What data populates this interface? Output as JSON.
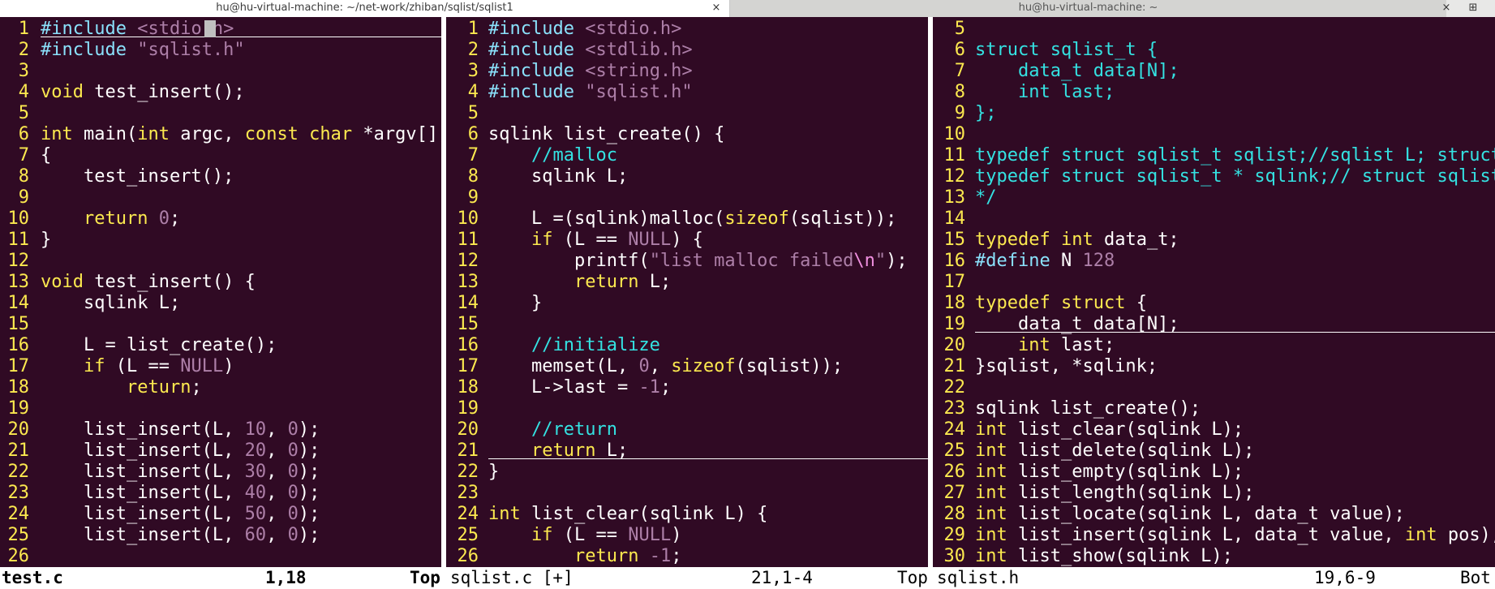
{
  "tabs": [
    {
      "title": "hu@hu-virtual-machine: ~/net-work/zhiban/sqlist/sqlist1",
      "close": "×",
      "active": true
    },
    {
      "title": "hu@hu-virtual-machine: ~",
      "close": "×",
      "active": false
    }
  ],
  "new_tab_icon": "⊞",
  "overflow_label": "Bot",
  "colors": {
    "background": "#300a24",
    "line_number": "#fce94f",
    "keyword": "#fce94f",
    "preprocessor": "#8ae1fb",
    "string": "#ad7fa8",
    "comment": "#34e2e2"
  },
  "panes": [
    {
      "id": "left",
      "lines": [
        {
          "n": "1",
          "tokens": [
            [
              "pp",
              "#include "
            ],
            [
              "str",
              "<stdio.h>"
            ]
          ]
        },
        {
          "n": "2",
          "tokens": [
            [
              "pp",
              "#include "
            ],
            [
              "str",
              "\"sqlist.h\""
            ]
          ]
        },
        {
          "n": "3",
          "tokens": []
        },
        {
          "n": "4",
          "tokens": [
            [
              "kw",
              "void"
            ],
            [
              "plain",
              " test_insert();"
            ]
          ]
        },
        {
          "n": "5",
          "tokens": []
        },
        {
          "n": "6",
          "tokens": [
            [
              "kw",
              "int"
            ],
            [
              "plain",
              " main("
            ],
            [
              "kw",
              "int"
            ],
            [
              "plain",
              " argc, "
            ],
            [
              "kw",
              "const char"
            ],
            [
              "plain",
              " *argv[])"
            ]
          ]
        },
        {
          "n": "7",
          "tokens": [
            [
              "plain",
              "{"
            ]
          ]
        },
        {
          "n": "8",
          "tokens": [
            [
              "plain",
              "    test_insert();"
            ]
          ]
        },
        {
          "n": "9",
          "tokens": []
        },
        {
          "n": "10",
          "tokens": [
            [
              "plain",
              "    "
            ],
            [
              "kw",
              "return"
            ],
            [
              "plain",
              " "
            ],
            [
              "num",
              "0"
            ],
            [
              "plain",
              ";"
            ]
          ]
        },
        {
          "n": "11",
          "tokens": [
            [
              "plain",
              "}"
            ]
          ]
        },
        {
          "n": "12",
          "tokens": []
        },
        {
          "n": "13",
          "tokens": [
            [
              "kw",
              "void"
            ],
            [
              "plain",
              " test_insert() {"
            ]
          ]
        },
        {
          "n": "14",
          "tokens": [
            [
              "plain",
              "    sqlink L;"
            ]
          ]
        },
        {
          "n": "15",
          "tokens": []
        },
        {
          "n": "16",
          "tokens": [
            [
              "plain",
              "    L = list_create();"
            ]
          ]
        },
        {
          "n": "17",
          "tokens": [
            [
              "plain",
              "    "
            ],
            [
              "kw",
              "if"
            ],
            [
              "plain",
              " (L == "
            ],
            [
              "num",
              "NULL"
            ],
            [
              "plain",
              ")"
            ]
          ]
        },
        {
          "n": "18",
          "tokens": [
            [
              "plain",
              "        "
            ],
            [
              "kw",
              "return"
            ],
            [
              "plain",
              ";"
            ]
          ]
        },
        {
          "n": "19",
          "tokens": []
        },
        {
          "n": "20",
          "tokens": [
            [
              "plain",
              "    list_insert(L, "
            ],
            [
              "num",
              "10"
            ],
            [
              "plain",
              ", "
            ],
            [
              "num",
              "0"
            ],
            [
              "plain",
              ");"
            ]
          ]
        },
        {
          "n": "21",
          "tokens": [
            [
              "plain",
              "    list_insert(L, "
            ],
            [
              "num",
              "20"
            ],
            [
              "plain",
              ", "
            ],
            [
              "num",
              "0"
            ],
            [
              "plain",
              ");"
            ]
          ]
        },
        {
          "n": "22",
          "tokens": [
            [
              "plain",
              "    list_insert(L, "
            ],
            [
              "num",
              "30"
            ],
            [
              "plain",
              ", "
            ],
            [
              "num",
              "0"
            ],
            [
              "plain",
              ");"
            ]
          ]
        },
        {
          "n": "23",
          "tokens": [
            [
              "plain",
              "    list_insert(L, "
            ],
            [
              "num",
              "40"
            ],
            [
              "plain",
              ", "
            ],
            [
              "num",
              "0"
            ],
            [
              "plain",
              ");"
            ]
          ]
        },
        {
          "n": "24",
          "tokens": [
            [
              "plain",
              "    list_insert(L, "
            ],
            [
              "num",
              "50"
            ],
            [
              "plain",
              ", "
            ],
            [
              "num",
              "0"
            ],
            [
              "plain",
              ");"
            ]
          ]
        },
        {
          "n": "25",
          "tokens": [
            [
              "plain",
              "    list_insert(L, "
            ],
            [
              "num",
              "60"
            ],
            [
              "plain",
              ", "
            ],
            [
              "num",
              "0"
            ],
            [
              "plain",
              ");"
            ]
          ]
        },
        {
          "n": "26",
          "tokens": []
        }
      ]
    },
    {
      "id": "middle",
      "lines": [
        {
          "n": "1",
          "tokens": [
            [
              "pp",
              "#include "
            ],
            [
              "str",
              "<stdio.h>"
            ]
          ]
        },
        {
          "n": "2",
          "tokens": [
            [
              "pp",
              "#include "
            ],
            [
              "str",
              "<stdlib.h>"
            ]
          ]
        },
        {
          "n": "3",
          "tokens": [
            [
              "pp",
              "#include "
            ],
            [
              "str",
              "<string.h>"
            ]
          ]
        },
        {
          "n": "4",
          "tokens": [
            [
              "pp",
              "#include "
            ],
            [
              "str",
              "\"sqlist.h\""
            ]
          ]
        },
        {
          "n": "5",
          "tokens": []
        },
        {
          "n": "6",
          "tokens": [
            [
              "plain",
              "sqlink list_create() {"
            ]
          ]
        },
        {
          "n": "7",
          "tokens": [
            [
              "plain",
              "    "
            ],
            [
              "cmt",
              "//malloc"
            ]
          ]
        },
        {
          "n": "8",
          "tokens": [
            [
              "plain",
              "    sqlink L;"
            ]
          ]
        },
        {
          "n": "9",
          "tokens": []
        },
        {
          "n": "10",
          "tokens": [
            [
              "plain",
              "    L =(sqlink)malloc("
            ],
            [
              "kw",
              "sizeof"
            ],
            [
              "plain",
              "(sqlist));"
            ]
          ]
        },
        {
          "n": "11",
          "tokens": [
            [
              "plain",
              "    "
            ],
            [
              "kw",
              "if"
            ],
            [
              "plain",
              " (L == "
            ],
            [
              "num",
              "NULL"
            ],
            [
              "plain",
              ") {"
            ]
          ]
        },
        {
          "n": "12",
          "tokens": [
            [
              "plain",
              "        printf("
            ],
            [
              "str",
              "\"list malloc failed"
            ],
            [
              "esc",
              "\\n"
            ],
            [
              "str",
              "\""
            ],
            [
              "plain",
              ");"
            ]
          ]
        },
        {
          "n": "13",
          "tokens": [
            [
              "plain",
              "        "
            ],
            [
              "kw",
              "return"
            ],
            [
              "plain",
              " L;"
            ]
          ]
        },
        {
          "n": "14",
          "tokens": [
            [
              "plain",
              "    }"
            ]
          ]
        },
        {
          "n": "15",
          "tokens": []
        },
        {
          "n": "16",
          "tokens": [
            [
              "plain",
              "    "
            ],
            [
              "cmt",
              "//initialize"
            ]
          ]
        },
        {
          "n": "17",
          "tokens": [
            [
              "plain",
              "    memset(L, "
            ],
            [
              "num",
              "0"
            ],
            [
              "plain",
              ", "
            ],
            [
              "kw",
              "sizeof"
            ],
            [
              "plain",
              "(sqlist));"
            ]
          ]
        },
        {
          "n": "18",
          "tokens": [
            [
              "plain",
              "    L->last = "
            ],
            [
              "num",
              "-1"
            ],
            [
              "plain",
              ";"
            ]
          ]
        },
        {
          "n": "19",
          "tokens": []
        },
        {
          "n": "20",
          "tokens": [
            [
              "plain",
              "    "
            ],
            [
              "cmt",
              "//return"
            ]
          ]
        },
        {
          "n": "21",
          "tokens": [
            [
              "plain",
              "    "
            ],
            [
              "kw",
              "return"
            ],
            [
              "plain",
              " L;"
            ]
          ]
        },
        {
          "n": "22",
          "tokens": [
            [
              "plain",
              "}"
            ]
          ]
        },
        {
          "n": "23",
          "tokens": []
        },
        {
          "n": "24",
          "tokens": [
            [
              "kw",
              "int"
            ],
            [
              "plain",
              " list_clear(sqlink L) {"
            ]
          ]
        },
        {
          "n": "25",
          "tokens": [
            [
              "plain",
              "    "
            ],
            [
              "kw",
              "if"
            ],
            [
              "plain",
              " (L == "
            ],
            [
              "num",
              "NULL"
            ],
            [
              "plain",
              ")"
            ]
          ]
        },
        {
          "n": "26",
          "tokens": [
            [
              "plain",
              "        "
            ],
            [
              "kw",
              "return"
            ],
            [
              "plain",
              " "
            ],
            [
              "num",
              "-1"
            ],
            [
              "plain",
              ";"
            ]
          ]
        }
      ]
    },
    {
      "id": "right",
      "lines": [
        {
          "n": "5",
          "tokens": []
        },
        {
          "n": "6",
          "tokens": [
            [
              "cmt",
              "struct sqlist_t {"
            ]
          ]
        },
        {
          "n": "7",
          "tokens": [
            [
              "cmt",
              "    data_t data[N];"
            ]
          ]
        },
        {
          "n": "8",
          "tokens": [
            [
              "cmt",
              "    int last;"
            ]
          ]
        },
        {
          "n": "9",
          "tokens": [
            [
              "cmt",
              "};"
            ]
          ]
        },
        {
          "n": "10",
          "tokens": []
        },
        {
          "n": "11",
          "tokens": [
            [
              "cmt",
              "typedef struct sqlist_t sqlist;//sqlist L; struct sql"
            ]
          ]
        },
        {
          "n": "12",
          "tokens": [
            [
              "cmt",
              "typedef struct sqlist_t * sqlink;// struct sqlist_t *"
            ]
          ]
        },
        {
          "n": "13",
          "tokens": [
            [
              "cmt",
              "*/"
            ]
          ]
        },
        {
          "n": "14",
          "tokens": []
        },
        {
          "n": "15",
          "tokens": [
            [
              "kw",
              "typedef"
            ],
            [
              "plain",
              " "
            ],
            [
              "kw",
              "int"
            ],
            [
              "plain",
              " data_t;"
            ]
          ]
        },
        {
          "n": "16",
          "tokens": [
            [
              "pp",
              "#define"
            ],
            [
              "plain",
              " N "
            ],
            [
              "num",
              "128"
            ]
          ]
        },
        {
          "n": "17",
          "tokens": []
        },
        {
          "n": "18",
          "tokens": [
            [
              "kw",
              "typedef"
            ],
            [
              "plain",
              " "
            ],
            [
              "kw",
              "struct"
            ],
            [
              "plain",
              " {"
            ]
          ]
        },
        {
          "n": "19",
          "tokens": [
            [
              "plain",
              "    data_t data[N];"
            ]
          ]
        },
        {
          "n": "20",
          "tokens": [
            [
              "plain",
              "    "
            ],
            [
              "kw",
              "int"
            ],
            [
              "plain",
              " last;"
            ]
          ]
        },
        {
          "n": "21",
          "tokens": [
            [
              "plain",
              "}sqlist, *sqlink;"
            ]
          ]
        },
        {
          "n": "22",
          "tokens": []
        },
        {
          "n": "23",
          "tokens": [
            [
              "plain",
              "sqlink list_create();"
            ]
          ]
        },
        {
          "n": "24",
          "tokens": [
            [
              "kw",
              "int"
            ],
            [
              "plain",
              " list_clear(sqlink L);"
            ]
          ]
        },
        {
          "n": "25",
          "tokens": [
            [
              "kw",
              "int"
            ],
            [
              "plain",
              " list_delete(sqlink L);"
            ]
          ]
        },
        {
          "n": "26",
          "tokens": [
            [
              "kw",
              "int"
            ],
            [
              "plain",
              " list_empty(sqlink L);"
            ]
          ]
        },
        {
          "n": "27",
          "tokens": [
            [
              "kw",
              "int"
            ],
            [
              "plain",
              " list_length(sqlink L);"
            ]
          ]
        },
        {
          "n": "28",
          "tokens": [
            [
              "kw",
              "int"
            ],
            [
              "plain",
              " list_locate(sqlink L, data_t value);"
            ]
          ]
        },
        {
          "n": "29",
          "tokens": [
            [
              "kw",
              "int"
            ],
            [
              "plain",
              " list_insert(sqlink L, data_t value, "
            ],
            [
              "kw",
              "int"
            ],
            [
              "plain",
              " pos);"
            ]
          ]
        },
        {
          "n": "30",
          "tokens": [
            [
              "kw",
              "int"
            ],
            [
              "plain",
              " list_show(sqlink L);"
            ]
          ]
        }
      ]
    }
  ],
  "status": {
    "left": {
      "file": "test.c",
      "pos": "1,18",
      "scroll": "Top"
    },
    "middle": {
      "file": "sqlist.c [+]",
      "pos": "21,1-4",
      "scroll": "Top"
    },
    "right": {
      "file": "sqlist.h",
      "pos": "19,6-9",
      "scroll": "Bot"
    }
  }
}
